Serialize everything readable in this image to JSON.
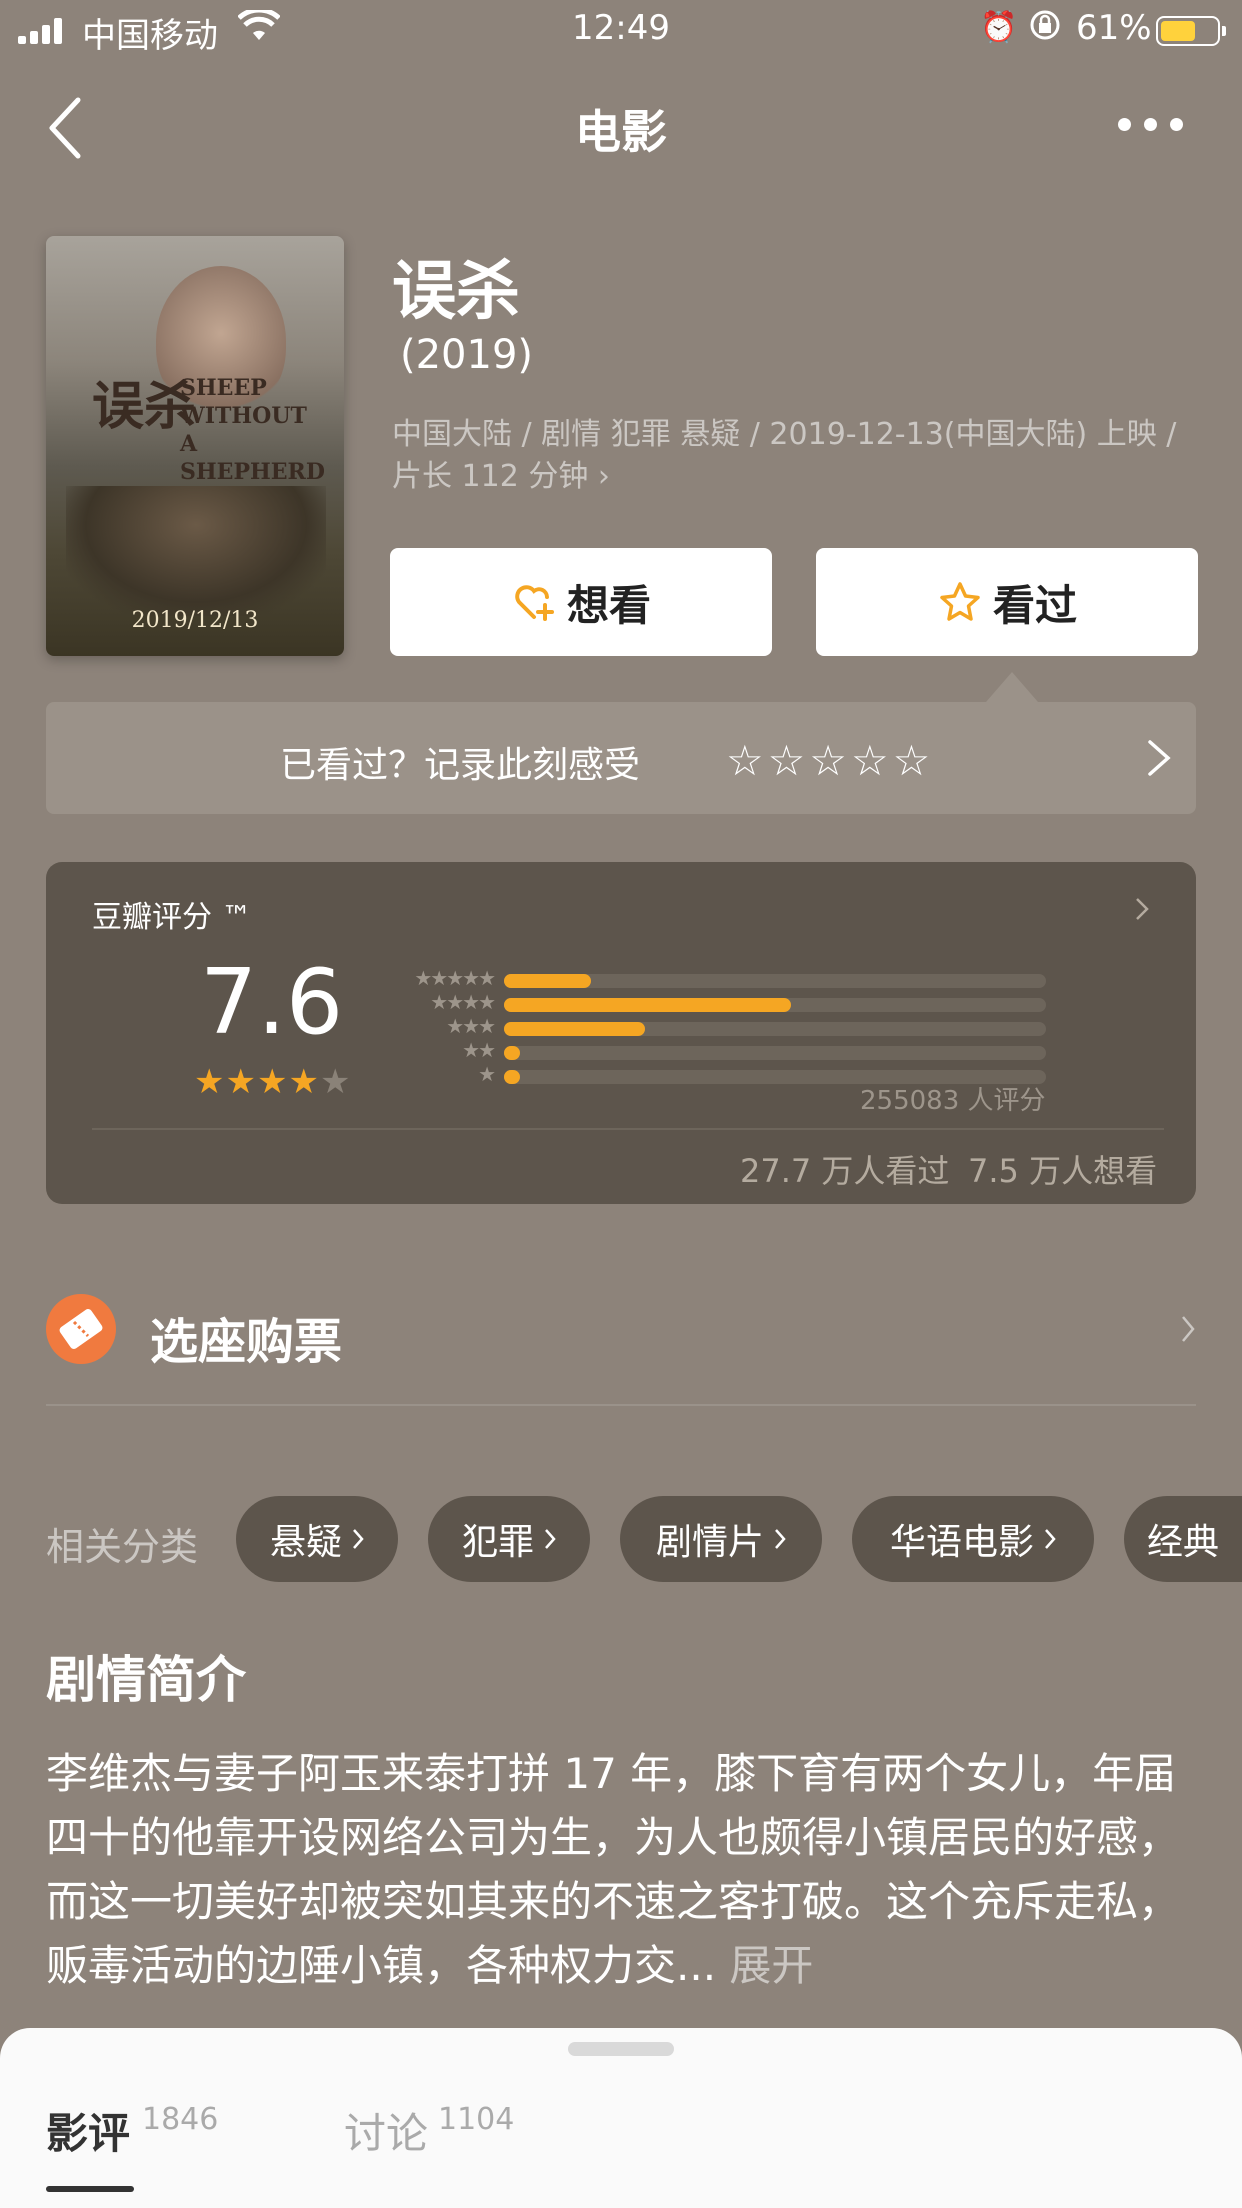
{
  "status_bar": {
    "carrier": "中国移动",
    "time": "12:49",
    "battery": "61%"
  },
  "nav": {
    "title": "电影"
  },
  "movie": {
    "title": "误杀",
    "year": "(2019)",
    "meta": "中国大陆 / 剧情 犯罪 悬疑 / 2019-12-13(中国大陆) 上映 / 片长 112 分钟 ›",
    "poster": {
      "cn_title": "误杀",
      "en_title": "SHEEP WITHOUT A SHEPHERD",
      "date": "2019/12/13"
    }
  },
  "actions": {
    "want_label": "想看",
    "seen_label": "看过"
  },
  "record": {
    "text": "已看过？记录此刻感受",
    "stars": "☆☆☆☆☆"
  },
  "rating": {
    "label": "豆瓣评分 ™",
    "score": "7.6",
    "stars_filled": 4,
    "distribution": [
      {
        "stars": "★★★★★",
        "fraction": 0.16
      },
      {
        "stars": "★★★★",
        "fraction": 0.53
      },
      {
        "stars": "★★★",
        "fraction": 0.26
      },
      {
        "stars": "★★",
        "fraction": 0.03
      },
      {
        "stars": "★",
        "fraction": 0.03
      }
    ],
    "count": "255083 人评分",
    "seen": "27.7 万人看过",
    "want": "7.5 万人想看"
  },
  "ticket": {
    "label": "选座购票"
  },
  "tags": {
    "label": "相关分类",
    "items": [
      "悬疑",
      "犯罪",
      "剧情片",
      "华语电影",
      "经典"
    ]
  },
  "synopsis": {
    "title": "剧情简介",
    "text": "李维杰与妻子阿玉来泰打拼 17 年，膝下育有两个女儿，年届四十的他靠开设网络公司为生，为人也颇得小镇居民的好感，而这一切美好却被突如其来的不速之客打破。这个充斥走私，贩毒活动的边陲小镇，各种权力交...",
    "more": "展开"
  },
  "sheet": {
    "tab_reviews": "影评",
    "tab_reviews_count": "1846",
    "tab_discuss": "讨论",
    "tab_discuss_count": "1104"
  },
  "colors": {
    "background": "#8d837a",
    "card": "#5d554c",
    "accent": "#f5a623",
    "ticket": "#f07a3f"
  }
}
